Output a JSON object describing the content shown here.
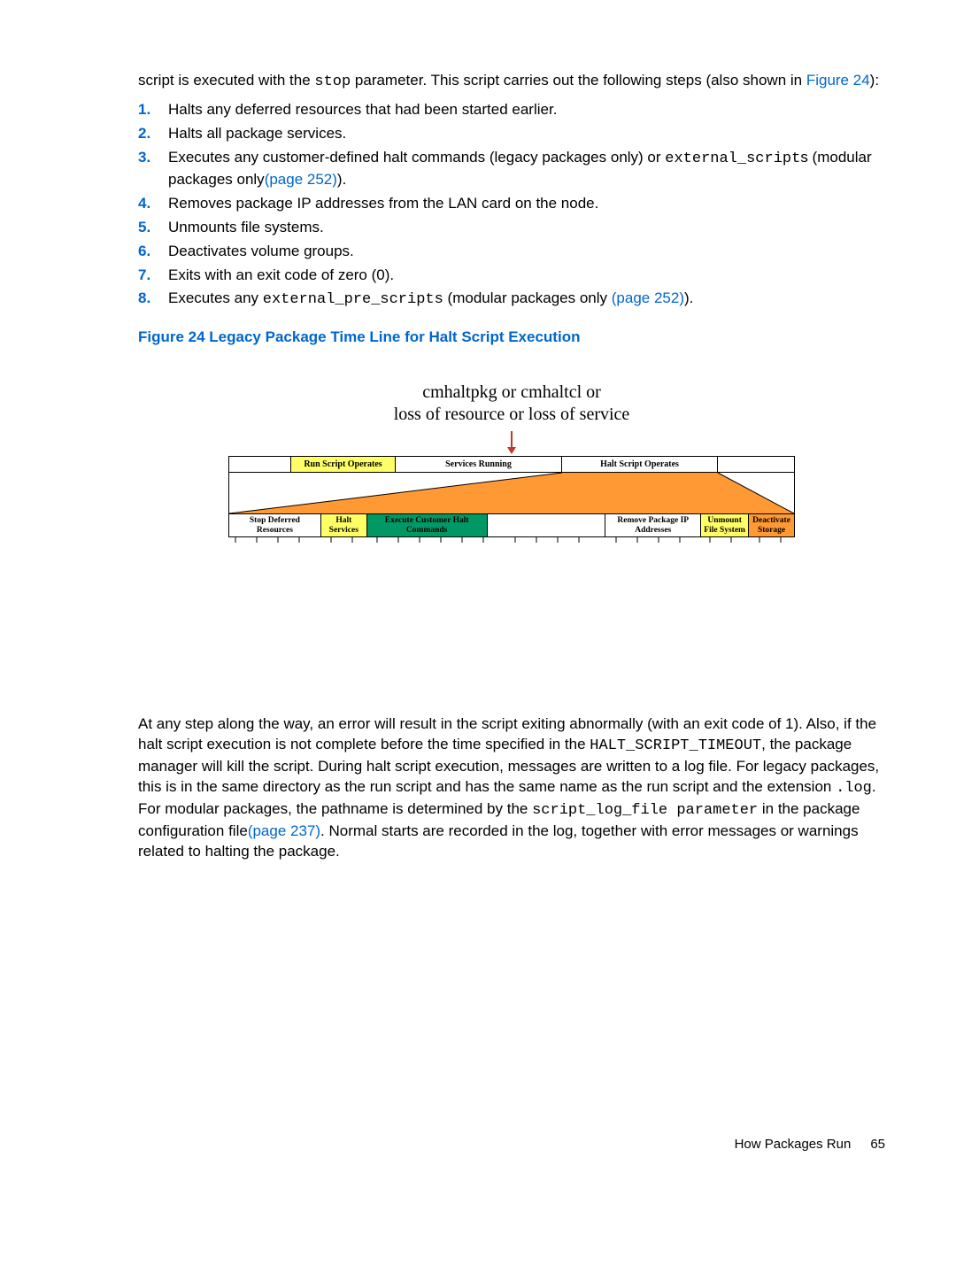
{
  "intro": {
    "p1a": "script is executed with the ",
    "code1": "stop",
    "p1b": " parameter. This script carries out the following steps (also shown in ",
    "link1": "Figure 24",
    "p1c": "):"
  },
  "steps": [
    {
      "n": "1.",
      "pre": "Halts any deferred resources that had been started earlier."
    },
    {
      "n": "2.",
      "pre": "Halts all package services."
    },
    {
      "n": "3.",
      "pre": "Executes any customer-defined halt commands (legacy packages only) or ",
      "code": "external_script",
      "post": "s (modular packages only",
      "link": "(page 252)",
      "tail": ")."
    },
    {
      "n": "4.",
      "pre": "Removes package IP addresses from the LAN card on the node."
    },
    {
      "n": "5.",
      "pre": "Unmounts file systems."
    },
    {
      "n": "6.",
      "pre": "Deactivates volume groups."
    },
    {
      "n": "7.",
      "pre": "Exits with an exit code of zero (0)."
    },
    {
      "n": "8.",
      "pre": "Executes any ",
      "code": "external_pre_scripts",
      "post": " (modular packages only ",
      "link": "(page 252)",
      "tail": ")."
    }
  ],
  "figTitle": "Figure 24 Legacy Package Time Line for Halt Script Execution",
  "fig": {
    "topline1": "cmhaltpkg or cmhaltcl or",
    "topline2": "loss of resource or loss of service",
    "row1": {
      "run": "Run Script Operates",
      "svc": "Services Running",
      "halt": "Halt Script Operates"
    },
    "row2": {
      "stopdef": "Stop Deferred Resources",
      "haltsvc": "Halt Services",
      "exec": "Execute Customer Halt Commands",
      "remip": "Remove Package IP Addresses",
      "umnt": "Unmount File System",
      "deact": "Deactivate Storage"
    }
  },
  "para": {
    "a": "At any step along the way, an error will result in the script exiting abnormally (with an exit code of 1). Also, if the halt script execution is not complete before the time specified in the ",
    "code1": "HALT_SCRIPT_TIMEOUT",
    "b": ", the package manager will kill the script. During halt script execution, messages are written to a log file. For legacy packages, this is in the same directory as the run script and has the same name as the run script and the extension ",
    "code2": ".log",
    "c": ". For modular packages, the pathname is determined by the ",
    "code3": "script_log_file parameter",
    "d": " in the package configuration file",
    "link": "(page 237)",
    "e": ". Normal starts are recorded in the log, together with error messages or warnings related to halting the package."
  },
  "footer": {
    "section": "How Packages Run",
    "page": "65"
  }
}
